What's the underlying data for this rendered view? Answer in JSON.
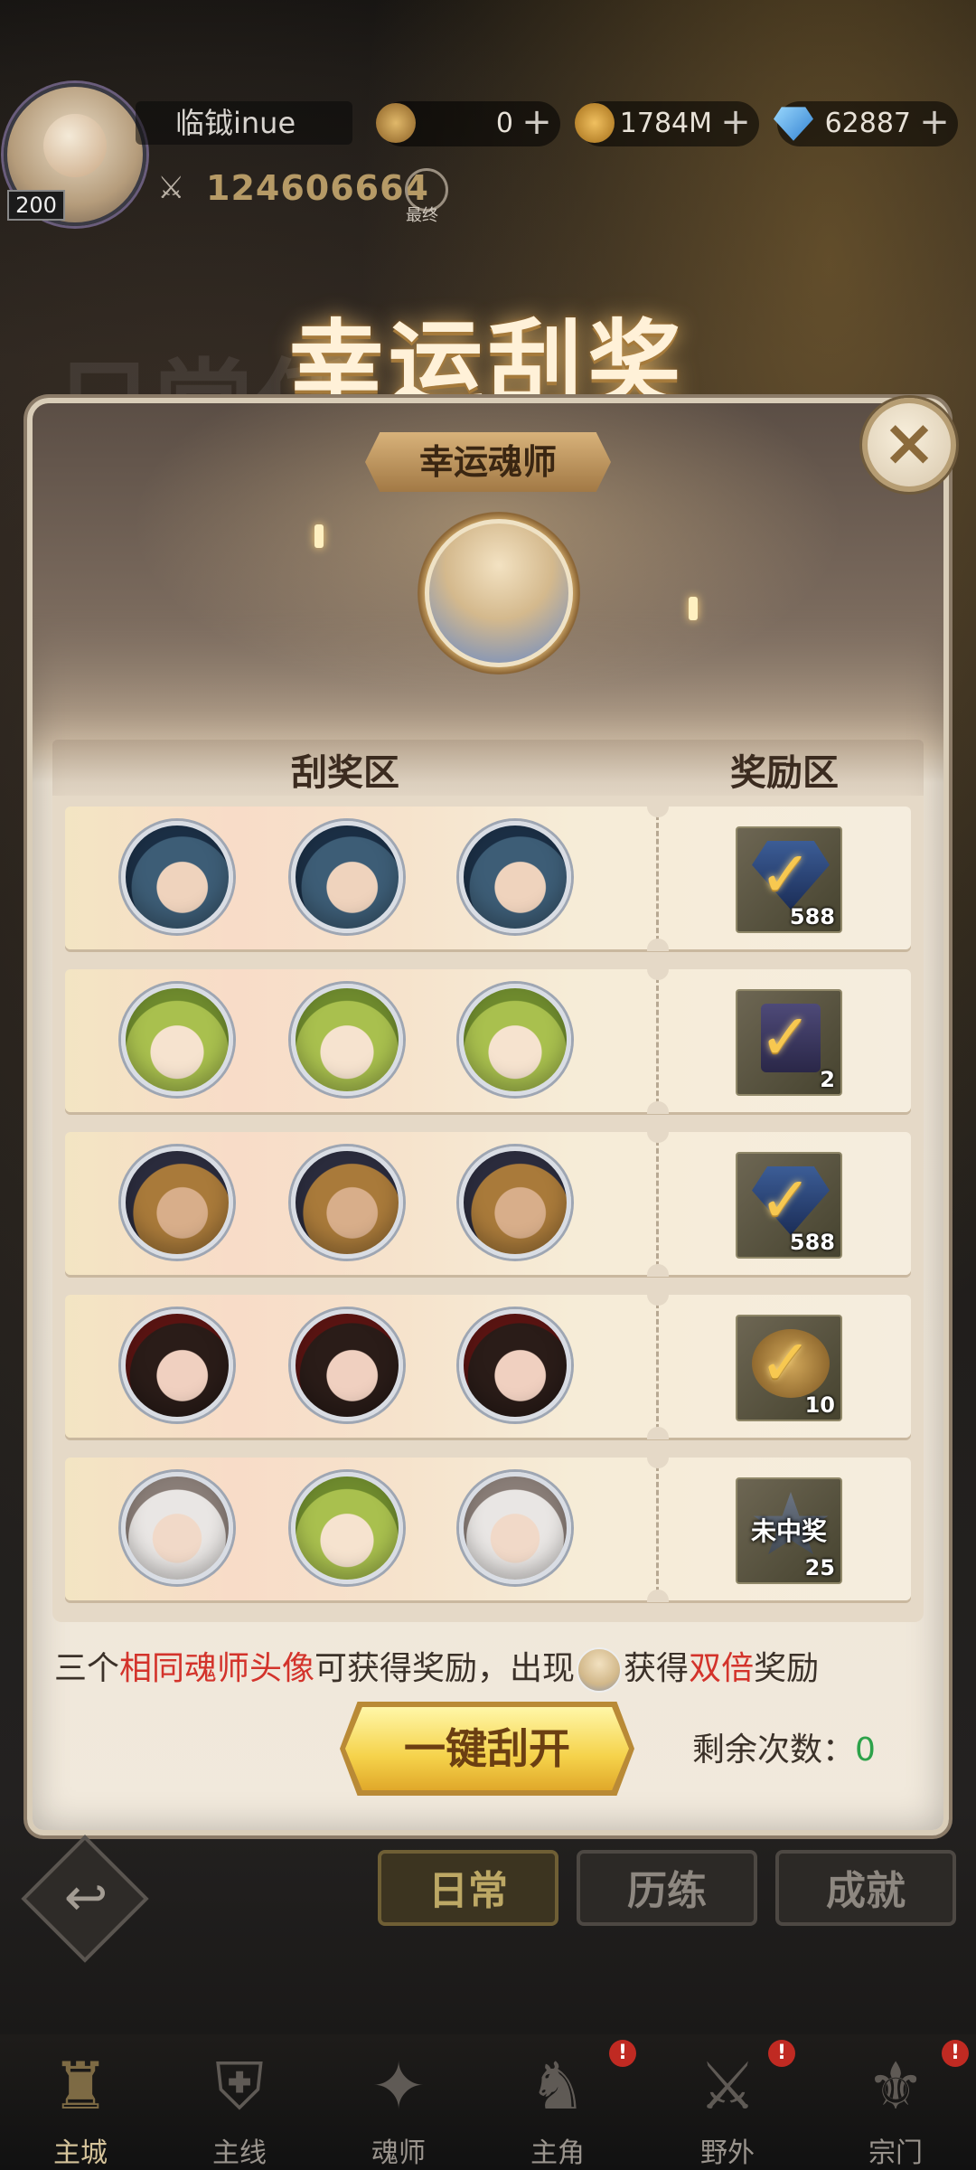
{
  "player": {
    "name": "临钺inue",
    "level": "200",
    "power": "124606664",
    "search_label": "最终"
  },
  "resources": [
    {
      "name": "soul-coin",
      "value": "0",
      "color": "#b58a46"
    },
    {
      "name": "gold-coin",
      "value": "1784M",
      "color": "#d29c3a"
    },
    {
      "name": "diamond",
      "value": "62887",
      "color": "#4fa0e6"
    }
  ],
  "title": "幸运刮奖",
  "background_ghost_text": "日常任",
  "panel": {
    "lucky_tag": "幸运魂师",
    "close_icon": "close-icon",
    "scratch_header": "刮奖区",
    "reward_header": "奖励区",
    "rows": [
      {
        "heroes": [
          "blue",
          "blue",
          "blue"
        ],
        "reward": {
          "type": "gem",
          "quantity": "588",
          "claimed": true
        }
      },
      {
        "heroes": [
          "green",
          "green",
          "green"
        ],
        "reward": {
          "type": "card",
          "quantity": "2",
          "claimed": true
        }
      },
      {
        "heroes": [
          "gold",
          "gold",
          "gold"
        ],
        "reward": {
          "type": "gem",
          "quantity": "588",
          "claimed": true
        }
      },
      {
        "heroes": [
          "dark",
          "dark",
          "dark"
        ],
        "reward": {
          "type": "coin",
          "quantity": "10",
          "claimed": true
        }
      },
      {
        "heroes": [
          "white",
          "green",
          "white"
        ],
        "reward": {
          "type": "star",
          "quantity": "25",
          "claimed": false,
          "label": "未中奖"
        }
      }
    ],
    "rule": {
      "p1": "三个",
      "p2": "相同魂师头像",
      "p3": "可获得奖励，出现",
      "p4": "获得",
      "p5": "双倍",
      "p6": "奖励"
    },
    "open_button": "一键刮开",
    "remaining_label": "剩余次数：",
    "remaining_value": "0"
  },
  "tabs": [
    {
      "label": "日常",
      "active": true
    },
    {
      "label": "历练",
      "active": false
    },
    {
      "label": "成就",
      "active": false
    }
  ],
  "nav": [
    {
      "label": "主城",
      "icon": "castle-icon",
      "active": true,
      "badge": false
    },
    {
      "label": "主线",
      "icon": "mainline-icon",
      "active": false,
      "badge": false
    },
    {
      "label": "魂师",
      "icon": "book-icon",
      "active": false,
      "badge": false
    },
    {
      "label": "主角",
      "icon": "hero-icon",
      "active": false,
      "badge": true
    },
    {
      "label": "野外",
      "icon": "wild-icon",
      "active": false,
      "badge": true
    },
    {
      "label": "宗门",
      "icon": "sect-icon",
      "active": false,
      "badge": true
    }
  ]
}
